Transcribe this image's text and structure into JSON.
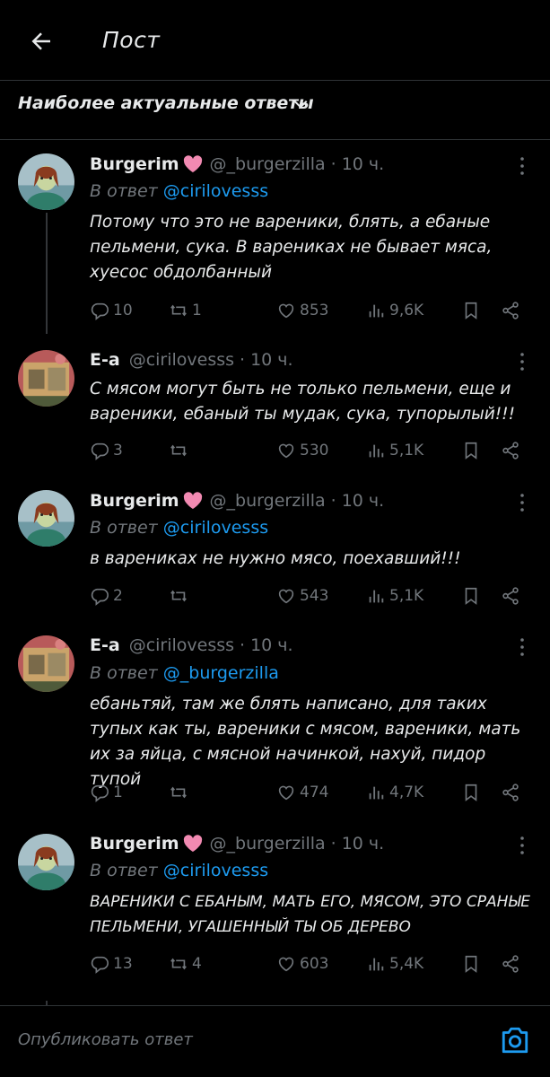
{
  "header": {
    "title": "Пост",
    "back_icon": "arrow-left-icon"
  },
  "sort": {
    "label": "Наиболее актуальные ответы",
    "icon": "chevron-down-icon"
  },
  "colors": {
    "accent": "#1d9bf0",
    "muted": "#71767b",
    "text": "#e7e9ea",
    "heart": "#f28ab2"
  },
  "tweets": [
    {
      "name": "Burgerim",
      "has_heart": true,
      "handle": "@_burgerzilla",
      "dot": "·",
      "time": "10 ч.",
      "reply_prefix": "В ответ",
      "reply_handle": "@cirilovesss",
      "text": "Потому что это не вареники, блять, а ебаные пельмени, сука. В варениках не бывает мяса, хуесос обдолбанный",
      "replies": "10",
      "reposts": "1",
      "likes": "853",
      "views": "9,6K"
    },
    {
      "name": "E-a",
      "has_heart": false,
      "handle": "@cirilovesss",
      "dot": "·",
      "time": "10 ч.",
      "reply_prefix": "",
      "reply_handle": "",
      "text": "С мясом могут быть не только пельмени, еще и вареники, ебаный ты мудак, сука, тупорылый!!!",
      "replies": "3",
      "reposts": "",
      "likes": "530",
      "views": "5,1K"
    },
    {
      "name": "Burgerim",
      "has_heart": true,
      "handle": "@_burgerzilla",
      "dot": "·",
      "time": "10 ч.",
      "reply_prefix": "В ответ",
      "reply_handle": "@cirilovesss",
      "text": "в варениках не нужно мясо, поехавший!!!",
      "replies": "2",
      "reposts": "",
      "likes": "543",
      "views": "5,1K"
    },
    {
      "name": "E-a",
      "has_heart": false,
      "handle": "@cirilovesss",
      "dot": "·",
      "time": "10 ч.",
      "reply_prefix": "В ответ",
      "reply_handle": "@_burgerzilla",
      "text": "ебаньтяй, там же блять написано, для таких тупых как ты, вареники с мясом, вареники, мать их за яйца, с мясной начинкой, нахуй, пидор тупой",
      "replies": "1",
      "reposts": "",
      "likes": "474",
      "views": "4,7K"
    },
    {
      "name": "Burgerim",
      "has_heart": true,
      "handle": "@_burgerzilla",
      "dot": "·",
      "time": "10 ч.",
      "reply_prefix": "В ответ",
      "reply_handle": "@cirilovesss",
      "text": "ВАРЕНИКИ С ЕБАНЫМ, МАТЬ ЕГО, МЯСОМ, ЭТО СРАНЫЕ ПЕЛЬМЕНИ, УГАШЕННЫЙ ТЫ ОБ ДЕРЕВО",
      "replies": "13",
      "reposts": "4",
      "likes": "603",
      "views": "5,4K"
    }
  ],
  "compose": {
    "placeholder": "Опубликовать ответ",
    "icon": "camera-icon"
  }
}
